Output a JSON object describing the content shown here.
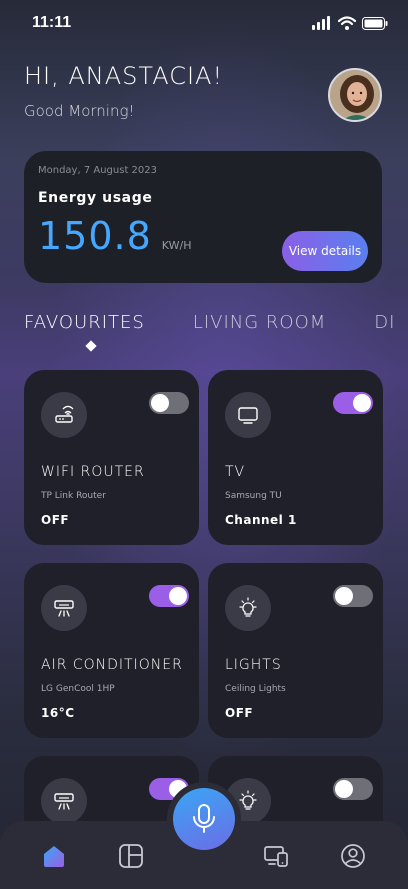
{
  "status_bar": {
    "time": "11:11"
  },
  "header": {
    "greeting": "HI, ANASTACIA!",
    "subgreeting": "Good Morning!"
  },
  "energy": {
    "date": "Monday, 7 August 2023",
    "title": "Energy usage",
    "value": "150.8",
    "unit": "KW/H",
    "button_label": "View details"
  },
  "tabs": [
    {
      "label": "FAVOURITES",
      "active": true
    },
    {
      "label": "LIVING ROOM",
      "active": false
    },
    {
      "label": "DI",
      "active": false
    }
  ],
  "devices": [
    {
      "name": "WIFI ROUTER",
      "subtitle": "TP Link Router",
      "status": "OFF",
      "toggle_on": false,
      "icon": "router-icon"
    },
    {
      "name": "TV",
      "subtitle": "Samsung TU",
      "status": "Channel 1",
      "toggle_on": true,
      "icon": "tv-icon"
    },
    {
      "name": "AIR CONDITIONER",
      "subtitle": "LG GenCool 1HP",
      "status": "16°C",
      "toggle_on": true,
      "icon": "air-conditioner-icon"
    },
    {
      "name": "LIGHTS",
      "subtitle": "Ceiling Lights",
      "status": "OFF",
      "toggle_on": false,
      "icon": "lightbulb-icon"
    },
    {
      "name": "",
      "subtitle": "",
      "status": "",
      "toggle_on": true,
      "icon": "air-conditioner-icon"
    },
    {
      "name": "",
      "subtitle": "",
      "status": "",
      "toggle_on": false,
      "icon": "lightbulb-icon"
    }
  ],
  "bottom_nav": [
    {
      "icon": "home-icon",
      "active": true
    },
    {
      "icon": "dashboard-icon",
      "active": false
    },
    {
      "icon": "mic-icon",
      "active": false
    },
    {
      "icon": "devices-icon",
      "active": false
    },
    {
      "icon": "profile-icon",
      "active": false
    }
  ],
  "colors": {
    "accent_blue": "#46a7ff",
    "accent_purple": "#9b5ee6",
    "card_bg": "#1f2029"
  }
}
